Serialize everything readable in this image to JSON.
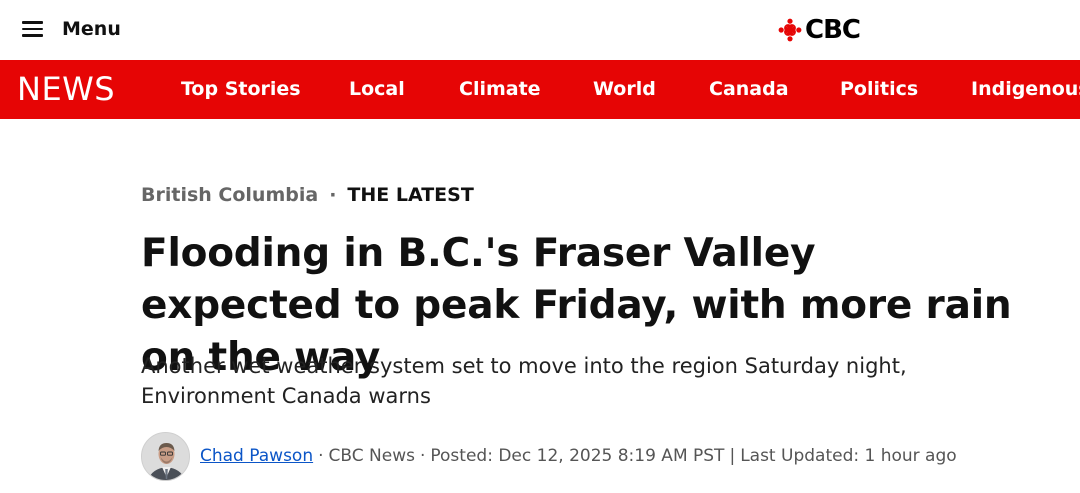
{
  "header": {
    "menu_label": "Menu",
    "logo_text": "CBC"
  },
  "nav": {
    "section_label": "NEWS",
    "items": [
      "Top Stories",
      "Local",
      "Climate",
      "World",
      "Canada",
      "Politics",
      "Indigenous"
    ]
  },
  "article": {
    "section": "British Columbia",
    "tag": "THE LATEST",
    "headline": "Flooding in B.C.'s Fraser Valley expected to peak Friday, with more rain on the way",
    "dek": "Another wet weather system set to move into the region Saturday night, Environment Canada warns",
    "byline": {
      "author": "Chad Pawson",
      "outlet": "CBC News",
      "posted": "Posted: Dec 12, 2025 8:19 AM PST",
      "updated": "Last Updated: 1 hour ago"
    }
  },
  "colors": {
    "brand_red": "#e60505",
    "link_blue": "#0b55c7"
  },
  "icons": [
    "hamburger-icon",
    "cbc-gem-icon",
    "author-avatar"
  ]
}
